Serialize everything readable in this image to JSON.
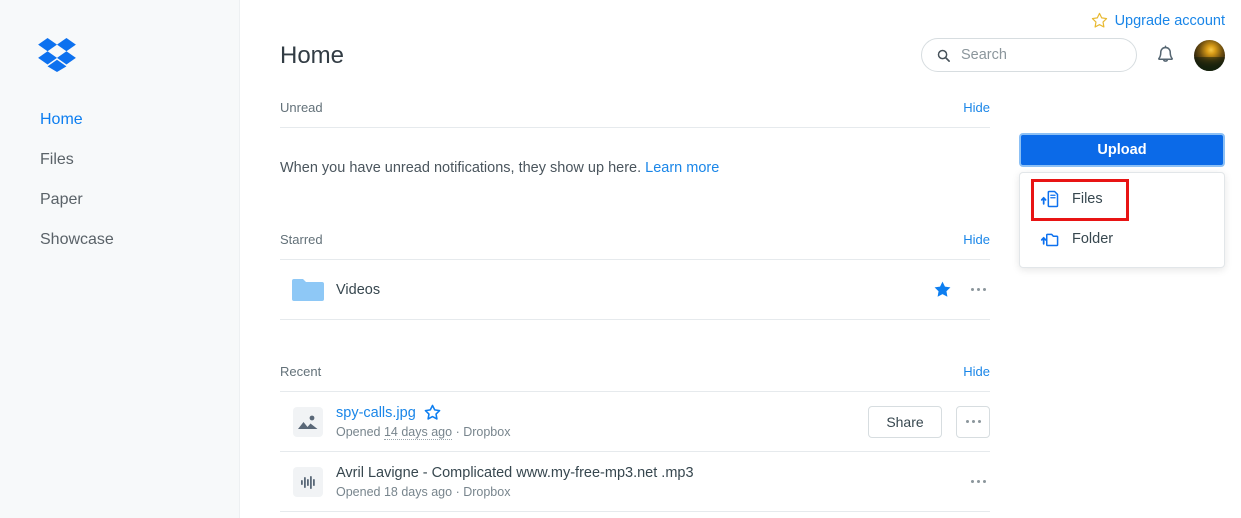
{
  "brand": {
    "logo_icon": "dropbox-logo-icon"
  },
  "sidebar": {
    "items": [
      {
        "label": "Home",
        "active": true
      },
      {
        "label": "Files",
        "active": false
      },
      {
        "label": "Paper",
        "active": false
      },
      {
        "label": "Showcase",
        "active": false
      }
    ]
  },
  "header": {
    "upgrade_label": "Upgrade account",
    "upgrade_icon": "star-outline-icon",
    "search": {
      "placeholder": "Search",
      "value": "",
      "icon": "search-icon"
    },
    "notifications_icon": "bell-icon",
    "avatar_icon": "avatar"
  },
  "main": {
    "page_title": "Home"
  },
  "sections": {
    "unread": {
      "title": "Unread",
      "hide_label": "Hide",
      "empty_text": "When you have unread notifications, they show up here.",
      "learn_more_label": "Learn more"
    },
    "starred": {
      "title": "Starred",
      "hide_label": "Hide",
      "rows": [
        {
          "name": "Videos",
          "icon": "folder-icon",
          "starred": true,
          "star_icon": "star-filled-icon",
          "overflow_icon": "ellipsis-icon"
        }
      ]
    },
    "recent": {
      "title": "Recent",
      "hide_label": "Hide",
      "rows": [
        {
          "name": "spy-calls.jpg",
          "icon": "image-file-icon",
          "star_icon": "star-outline-icon",
          "opened_prefix": "Opened",
          "opened_when": "14 days ago",
          "location_sep": "·",
          "location": "Dropbox",
          "share_label": "Share",
          "overflow_icon": "ellipsis-icon"
        },
        {
          "name": "Avril Lavigne - Complicated www.my-free-mp3.net .mp3",
          "icon": "audio-file-icon",
          "opened_prefix": "Opened",
          "opened_when": "18 days ago",
          "location_sep": "·",
          "location": "Dropbox",
          "overflow_icon": "ellipsis-icon"
        }
      ]
    }
  },
  "upload": {
    "button_label": "Upload",
    "menu": [
      {
        "label": "Files",
        "icon": "upload-file-icon",
        "highlighted": true
      },
      {
        "label": "Folder",
        "icon": "upload-folder-icon",
        "highlighted": false
      }
    ]
  },
  "colors": {
    "brand_blue": "#0b6ae8",
    "link_blue": "#1a86e8",
    "sidebar_bg": "#f7f9fa",
    "highlight_red": "#e81414",
    "star_gold": "#e8b931",
    "folder_blue": "#8ec8f6"
  }
}
